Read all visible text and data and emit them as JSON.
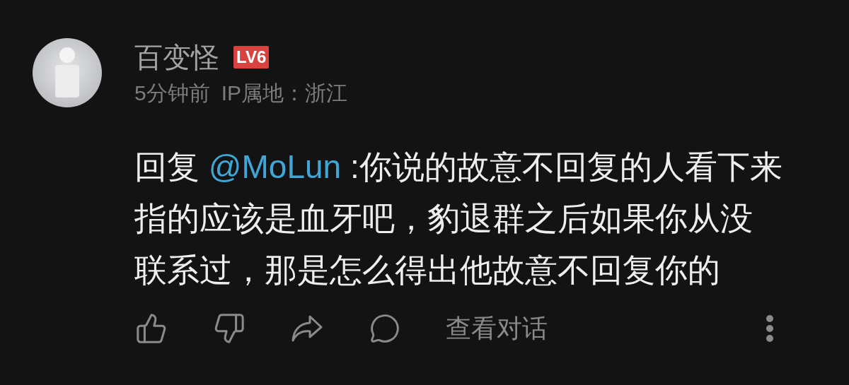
{
  "comment": {
    "author": "百变怪",
    "level_badge": "LV6",
    "time": "5分钟前",
    "ip_location": "IP属地：浙江",
    "reply_prefix": "回复",
    "mention": "@MoLun",
    "text_lines": [
      ":你说的故意不回复的人看下来",
      "指的应该是血牙吧，豹退群之后如果你从没",
      "联系过，那是怎么得出他故意不回复你的"
    ],
    "view_conversation": "查看对话"
  }
}
